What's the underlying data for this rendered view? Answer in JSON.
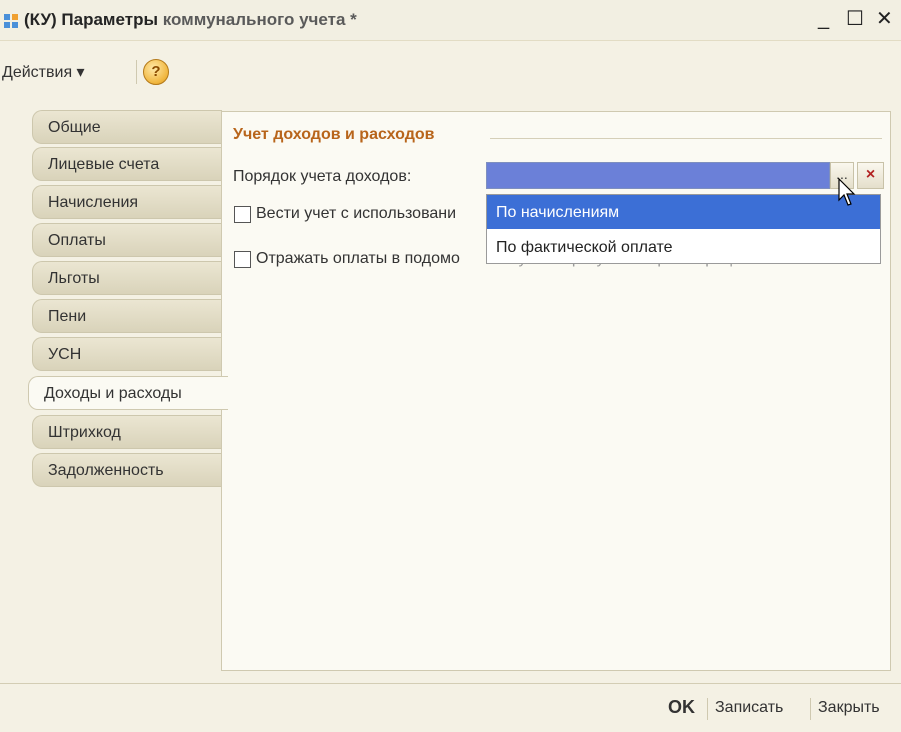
{
  "window": {
    "title_prefix": "(КУ) Параметры",
    "title_rest": " коммунального учета *",
    "minimize": "_",
    "maximize": "☐",
    "close": "✕"
  },
  "toolbar": {
    "actions_label": "Действия ▾",
    "help_label": "?"
  },
  "tabs": [
    {
      "label": "Общие"
    },
    {
      "label": "Лицевые счета"
    },
    {
      "label": "Начисления"
    },
    {
      "label": "Оплаты"
    },
    {
      "label": "Льготы"
    },
    {
      "label": "Пени"
    },
    {
      "label": "УСН"
    },
    {
      "label": "Доходы и расходы",
      "active": true
    },
    {
      "label": "Штрихкод"
    },
    {
      "label": "Задолженность"
    }
  ],
  "panel": {
    "group_title": "Учет доходов и расходов",
    "order_label": "Порядок учета доходов:",
    "order_value": "",
    "select_button": "...",
    "clear_button": "×",
    "checkbox1_label": "Вести учет с использовани",
    "checkbox2_label": "Отражать оплаты в подомо",
    "checkbox2_hidden_tail": "вом учете сразу после регистрации"
  },
  "dropdown": {
    "options": [
      "По начислениям",
      "По фактической оплате"
    ],
    "selected": "По начислениям"
  },
  "footer": {
    "ok": "OK",
    "save": "Записать",
    "close": "Закрыть"
  }
}
